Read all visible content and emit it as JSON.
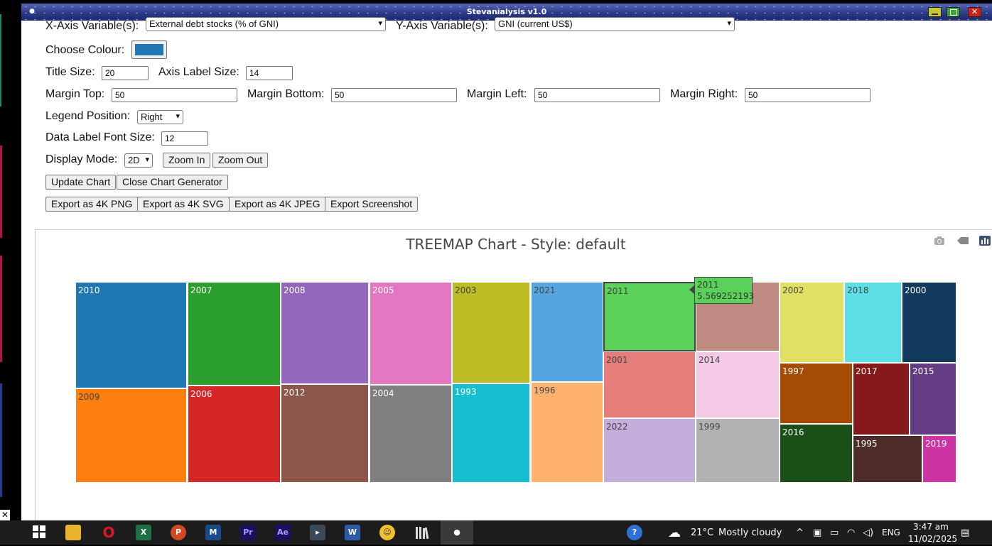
{
  "window": {
    "title": "Stevanialysis v1.0",
    "close_glyph": "✕"
  },
  "controls": {
    "x_axis_label": "X-Axis Variable(s):",
    "x_axis_value": "External debt stocks (% of GNI)",
    "y_axis_label": "Y-Axis Variable(s):",
    "y_axis_value": "GNI (current US$)",
    "colour_label": "Choose Colour:",
    "colour_value": "#1f77b4",
    "title_size_label": "Title Size:",
    "title_size_value": "20",
    "axis_label_size_label": "Axis Label Size:",
    "axis_label_size_value": "14",
    "margin_top_label": "Margin Top:",
    "margin_top_value": "50",
    "margin_bottom_label": "Margin Bottom:",
    "margin_bottom_value": "50",
    "margin_left_label": "Margin Left:",
    "margin_left_value": "50",
    "margin_right_label": "Margin Right:",
    "margin_right_value": "50",
    "legend_position_label": "Legend Position:",
    "legend_position_value": "Right",
    "data_label_font_size_label": "Data Label Font Size:",
    "data_label_font_size_value": "12",
    "display_mode_label": "Display Mode:",
    "display_mode_value": "2D",
    "zoom_in": "Zoom In",
    "zoom_out": "Zoom Out",
    "update_chart": "Update Chart",
    "close_chart_generator": "Close Chart Generator",
    "export_png": "Export as 4K PNG",
    "export_svg": "Export as 4K SVG",
    "export_jpeg": "Export as 4K JPEG",
    "export_screenshot": "Export Screenshot"
  },
  "chart_data": {
    "type": "treemap",
    "title": "TREEMAP Chart - Style: default",
    "tiles": [
      {
        "label": "2010",
        "color": "#1f77b4"
      },
      {
        "label": "2009",
        "color": "#ff7f0e"
      },
      {
        "label": "2007",
        "color": "#2ca02c"
      },
      {
        "label": "2006",
        "color": "#d62728"
      },
      {
        "label": "2008",
        "color": "#9467bd"
      },
      {
        "label": "2012",
        "color": "#8c564b"
      },
      {
        "label": "2005",
        "color": "#e377c2"
      },
      {
        "label": "2004",
        "color": "#7f7f7f"
      },
      {
        "label": "2003",
        "color": "#bcbd22"
      },
      {
        "label": "1993",
        "color": "#17becf"
      },
      {
        "label": "2021",
        "color": "#54a5e0"
      },
      {
        "label": "1996",
        "color": "#ffb26e"
      },
      {
        "label": "2011",
        "color": "#5ad25a"
      },
      {
        "label": "",
        "color": "#c08b83"
      },
      {
        "label": "2001",
        "color": "#e57d7b"
      },
      {
        "label": "2014",
        "color": "#f4c9e5"
      },
      {
        "label": "2022",
        "color": "#c5aedc"
      },
      {
        "label": "1999",
        "color": "#b2b2b2"
      },
      {
        "label": "2002",
        "color": "#e2e062"
      },
      {
        "label": "2018",
        "color": "#5ddfe8"
      },
      {
        "label": "2000",
        "color": "#123a5c"
      },
      {
        "label": "1997",
        "color": "#a64b04"
      },
      {
        "label": "2017",
        "color": "#861a1a"
      },
      {
        "label": "2015",
        "color": "#643c84"
      },
      {
        "label": "2016",
        "color": "#1a5017"
      },
      {
        "label": "1995",
        "color": "#4e2d28"
      },
      {
        "label": "2019",
        "color": "#cc34a4"
      }
    ],
    "hover": {
      "label": "2011",
      "value": "5.569252193"
    }
  },
  "taskbar": {
    "weather_temp": "21°C",
    "weather_text": "Mostly cloudy",
    "language": "ENG",
    "time": "3:47 am",
    "date": "11/02/2025",
    "apps": [
      "start-icon",
      "file-explorer-icon",
      "opera-icon",
      "excel-icon",
      "powerpoint-icon",
      "maple-icon",
      "premiere-icon",
      "after-effects-icon",
      "terminal-icon",
      "word-icon",
      "emoji-app-icon",
      "library-icon",
      "stevanialysis-icon"
    ]
  }
}
